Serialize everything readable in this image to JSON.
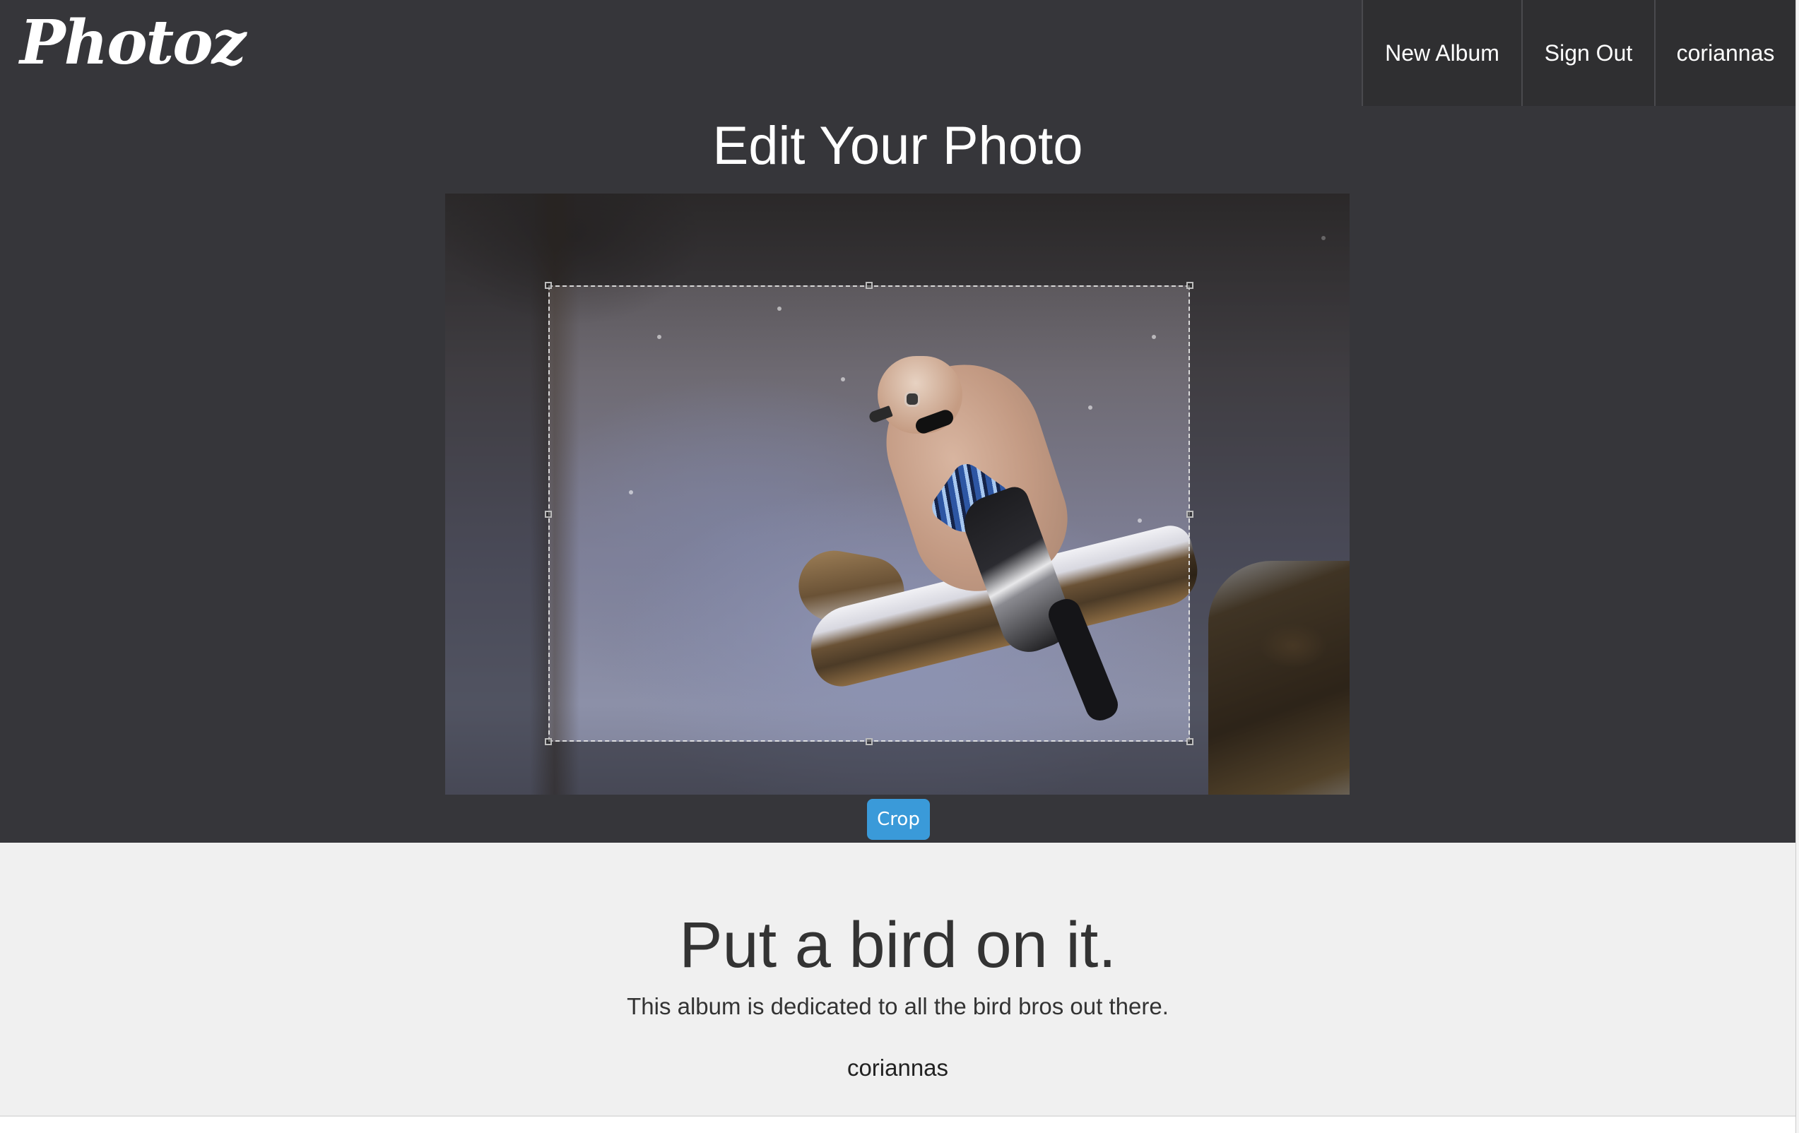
{
  "header": {
    "logo": "Photoz",
    "nav": {
      "new_album": "New Album",
      "sign_out": "Sign Out",
      "username": "coriannas"
    }
  },
  "editor": {
    "title": "Edit Your Photo",
    "crop_button": "Crop"
  },
  "album": {
    "title": "Put a bird on it.",
    "description": "This album is dedicated to all the bird bros out there.",
    "owner": "coriannas"
  },
  "colors": {
    "dark_background": "#36363a",
    "nav_background": "#2f2f31",
    "crop_button": "#3a9ad9",
    "album_background": "#f0f0f0"
  }
}
